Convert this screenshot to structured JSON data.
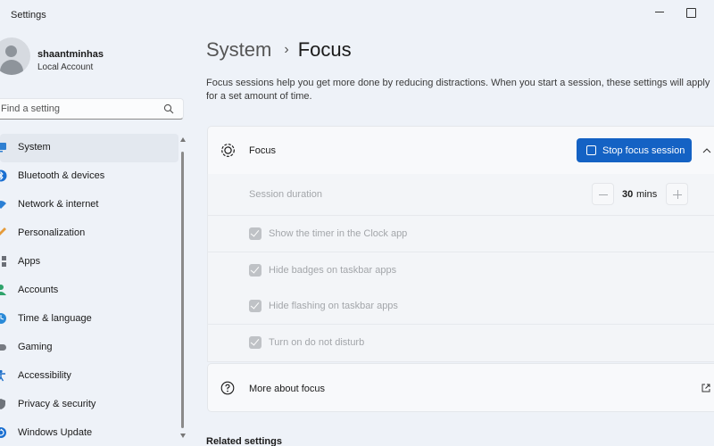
{
  "app": {
    "title": "Settings"
  },
  "account": {
    "name": "shaantminhas",
    "type": "Local Account"
  },
  "search": {
    "placeholder": "Find a setting"
  },
  "sidebar": {
    "items": [
      {
        "label": "System",
        "icon": "monitor-icon",
        "selected": true
      },
      {
        "label": "Bluetooth & devices",
        "icon": "bluetooth-icon"
      },
      {
        "label": "Network & internet",
        "icon": "wifi-icon"
      },
      {
        "label": "Personalization",
        "icon": "brush-icon"
      },
      {
        "label": "Apps",
        "icon": "apps-icon"
      },
      {
        "label": "Accounts",
        "icon": "person-icon"
      },
      {
        "label": "Time & language",
        "icon": "globe-clock-icon"
      },
      {
        "label": "Gaming",
        "icon": "controller-icon"
      },
      {
        "label": "Accessibility",
        "icon": "accessibility-icon"
      },
      {
        "label": "Privacy & security",
        "icon": "shield-icon"
      },
      {
        "label": "Windows Update",
        "icon": "update-icon"
      }
    ]
  },
  "breadcrumb": {
    "parent": "System",
    "separator": "›",
    "current": "Focus"
  },
  "description": "Focus sessions help you get more done by reducing distractions. When you start a session, these settings will apply for a set amount of time.",
  "focus_card": {
    "label": "Focus",
    "button": "Stop focus session"
  },
  "session": {
    "label": "Session duration",
    "value": "30",
    "unit": "mins"
  },
  "options": [
    {
      "label": "Show the timer in the Clock app",
      "checked": true
    },
    {
      "label": "Hide badges on taskbar apps",
      "checked": true
    },
    {
      "label": "Hide flashing on taskbar apps",
      "checked": true
    },
    {
      "label": "Turn on do not disturb",
      "checked": true
    }
  ],
  "more_card": {
    "label": "More about focus"
  },
  "related": {
    "heading": "Related settings"
  },
  "colors": {
    "accent": "#1462c4",
    "background": "#eef2f8"
  }
}
